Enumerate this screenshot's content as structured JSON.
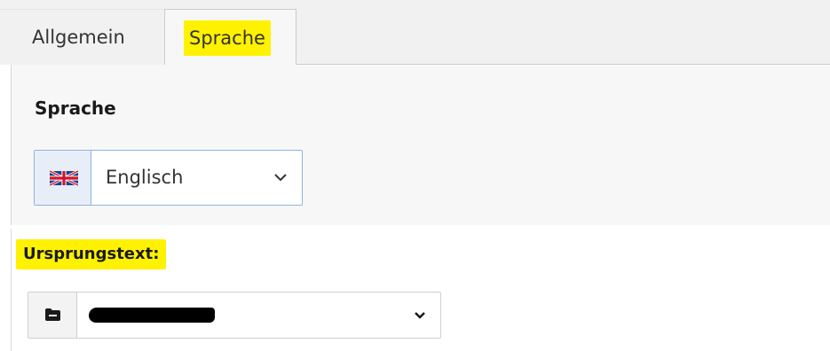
{
  "tabs": [
    {
      "label": "Allgemein",
      "active": false
    },
    {
      "label": "Sprache",
      "active": true
    }
  ],
  "language": {
    "heading": "Sprache",
    "flag_icon": "uk-flag-icon",
    "selected": "Englisch",
    "chevron_icon": "chevron-down-icon"
  },
  "source": {
    "label": "Ursprungstext:",
    "icon": "folder-icon",
    "selected_redacted": true,
    "chevron_icon": "chevron-down-icon"
  },
  "colors": {
    "highlight": "#fff200",
    "focus_border": "#8cb4e6",
    "tab_bg": "#f1f1f1"
  }
}
